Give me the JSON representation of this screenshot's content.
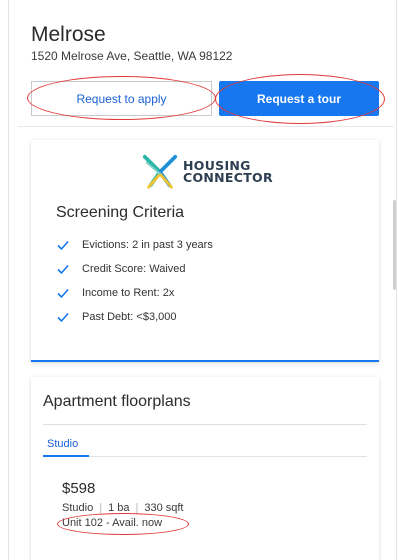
{
  "property": {
    "name": "Melrose",
    "address": "1520 Melrose Ave, Seattle, WA 98122"
  },
  "actions": {
    "apply_label": "Request to apply",
    "tour_label": "Request a tour"
  },
  "screening": {
    "logo_line1": "HOUSING",
    "logo_line2": "CONNECTOR",
    "title": "Screening Criteria",
    "items": [
      "Evictions: 2 in past 3 years",
      "Credit Score: Waived",
      "Income to Rent: 2x",
      "Past Debt: <$3,000"
    ]
  },
  "floorplans": {
    "title": "Apartment floorplans",
    "tabs": [
      "Studio"
    ],
    "unit": {
      "price": "$598",
      "type": "Studio",
      "baths": "1 ba",
      "sqft": "330 sqft",
      "availability": "Unit 102 - Avail. now"
    }
  },
  "colors": {
    "accent": "#1677f0",
    "link": "#1a62d6",
    "annotation": "#e23a3a",
    "logo_teal": "#2bb5a8",
    "logo_blue": "#1f8fd6",
    "logo_yellow": "#f2c230"
  }
}
